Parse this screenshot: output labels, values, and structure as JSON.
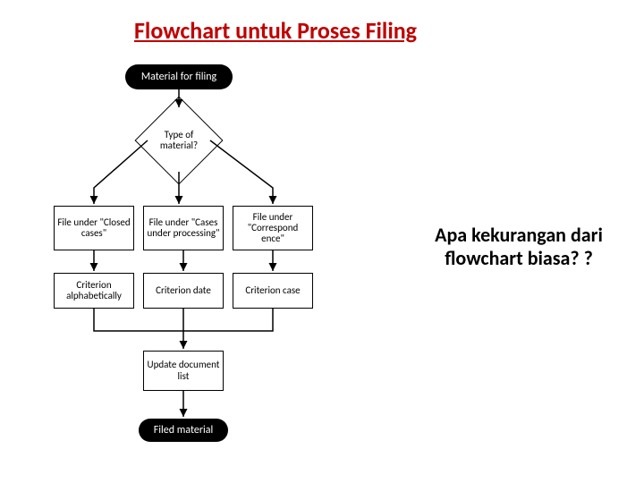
{
  "title": "Flowchart untuk Proses Filing",
  "question": "Apa kekurangan dari flowchart biasa? ?",
  "nodes": {
    "start": "Material for filing",
    "decision": "Type of material?",
    "file_closed": "File under \"Closed cases\"",
    "file_processing": "File under \"Cases under processing\"",
    "file_correspond": "File under \"Correspond ence\"",
    "crit_alpha": "Criterion alphabetically",
    "crit_date": "Criterion date",
    "crit_case": "Criterion case",
    "update": "Update document list",
    "end": "Filed material"
  }
}
